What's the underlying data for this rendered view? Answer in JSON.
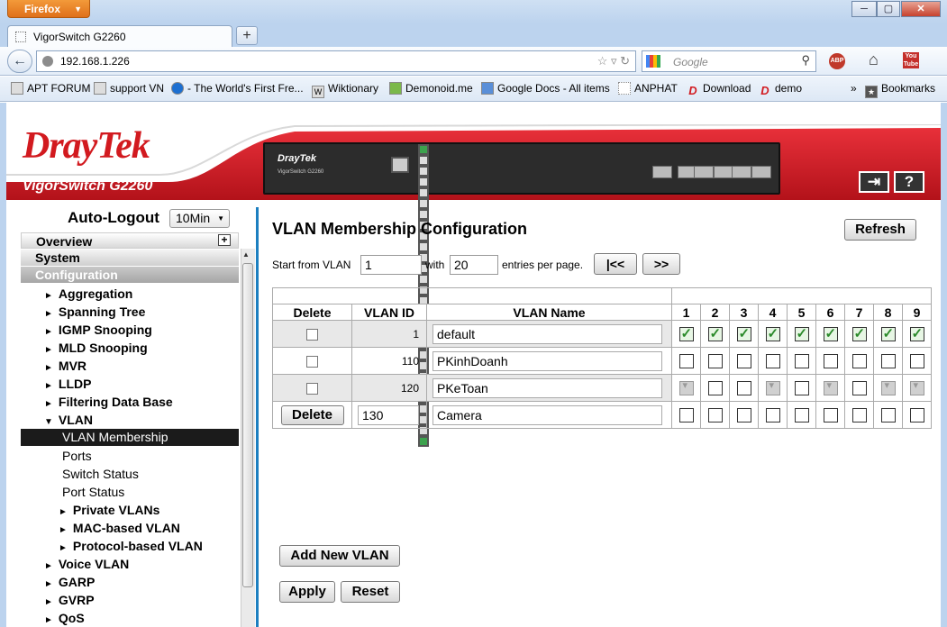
{
  "browser": {
    "menu_label": "Firefox",
    "tab_title": "VigorSwitch G2260",
    "url": "192.168.1.226",
    "search_placeholder": "Google",
    "bookmarks": [
      "APT FORUM",
      "support VN",
      "- The World's First Fre...",
      "Wiktionary",
      "Demonoid.me",
      "Google Docs - All items",
      "ANPHAT",
      "Download",
      "demo"
    ],
    "bookmarks_menu": "Bookmarks",
    "adblock_label": "ABP",
    "youtube_label": "You Tube"
  },
  "header": {
    "brand": "DrayTek",
    "model": "VigorSwitch G2260",
    "switch_brand": "DrayTek",
    "switch_model": "VigorSwitch G2260",
    "brand_color": "#d21a1f"
  },
  "sidebar": {
    "auto_logout_label": "Auto-Logout",
    "auto_logout_value": "10Min",
    "sections": {
      "overview": "Overview",
      "system": "System",
      "configuration": "Configuration"
    },
    "items": [
      {
        "label": "Aggregation",
        "level": 1,
        "arrow": "►"
      },
      {
        "label": "Spanning Tree",
        "level": 1,
        "arrow": "►"
      },
      {
        "label": "IGMP Snooping",
        "level": 1,
        "arrow": "►"
      },
      {
        "label": "MLD Snooping",
        "level": 1,
        "arrow": "►"
      },
      {
        "label": "MVR",
        "level": 1,
        "arrow": "►"
      },
      {
        "label": "LLDP",
        "level": 1,
        "arrow": "►"
      },
      {
        "label": "Filtering Data Base",
        "level": 1,
        "arrow": "►"
      },
      {
        "label": "VLAN",
        "level": 1,
        "arrow": "▼"
      },
      {
        "label": "VLAN Membership",
        "level": 2,
        "selected": true
      },
      {
        "label": "Ports",
        "level": 2
      },
      {
        "label": "Switch Status",
        "level": 2
      },
      {
        "label": "Port Status",
        "level": 2
      },
      {
        "label": "Private VLANs",
        "level": 3,
        "arrow": "►"
      },
      {
        "label": "MAC-based VLAN",
        "level": 3,
        "arrow": "►"
      },
      {
        "label": "Protocol-based VLAN",
        "level": 3,
        "arrow": "►"
      },
      {
        "label": "Voice VLAN",
        "level": 1,
        "arrow": "►"
      },
      {
        "label": "GARP",
        "level": 1,
        "arrow": "►"
      },
      {
        "label": "GVRP",
        "level": 1,
        "arrow": "►"
      },
      {
        "label": "QoS",
        "level": 1,
        "arrow": "►"
      }
    ]
  },
  "main": {
    "title": "VLAN Membership Configuration",
    "refresh_label": "Refresh",
    "start_from_label": "Start from VLAN",
    "start_from_value": "1",
    "with_label": "with",
    "entries_value": "20",
    "entries_label": "entries per page.",
    "first_page_label": "|<<",
    "next_page_label": ">>",
    "table": {
      "headers": {
        "delete": "Delete",
        "vlan_id": "VLAN ID",
        "vlan_name": "VLAN Name"
      },
      "ports": [
        "1",
        "2",
        "3",
        "4",
        "5",
        "6",
        "7",
        "8",
        "9"
      ],
      "rows": [
        {
          "delete": "checkbox",
          "id": "1",
          "name": "default",
          "ports": [
            "on",
            "on",
            "on",
            "on",
            "on",
            "on",
            "on",
            "on",
            "on"
          ]
        },
        {
          "delete": "checkbox",
          "id": "110",
          "name": "PKinhDoanh",
          "ports": [
            "off",
            "off",
            "off",
            "off",
            "off",
            "off",
            "off",
            "off",
            "off"
          ]
        },
        {
          "delete": "checkbox",
          "id": "120",
          "name": "PKeToan",
          "ports": [
            "dis",
            "off",
            "off",
            "dis",
            "off",
            "dis",
            "off",
            "dis",
            "dis"
          ]
        },
        {
          "delete": "Delete",
          "id": "130",
          "name": "Camera",
          "ports": [
            "off",
            "off",
            "off",
            "off",
            "off",
            "off",
            "off",
            "off",
            "off"
          ]
        }
      ]
    },
    "add_new_label": "Add New VLAN",
    "apply_label": "Apply",
    "reset_label": "Reset"
  }
}
